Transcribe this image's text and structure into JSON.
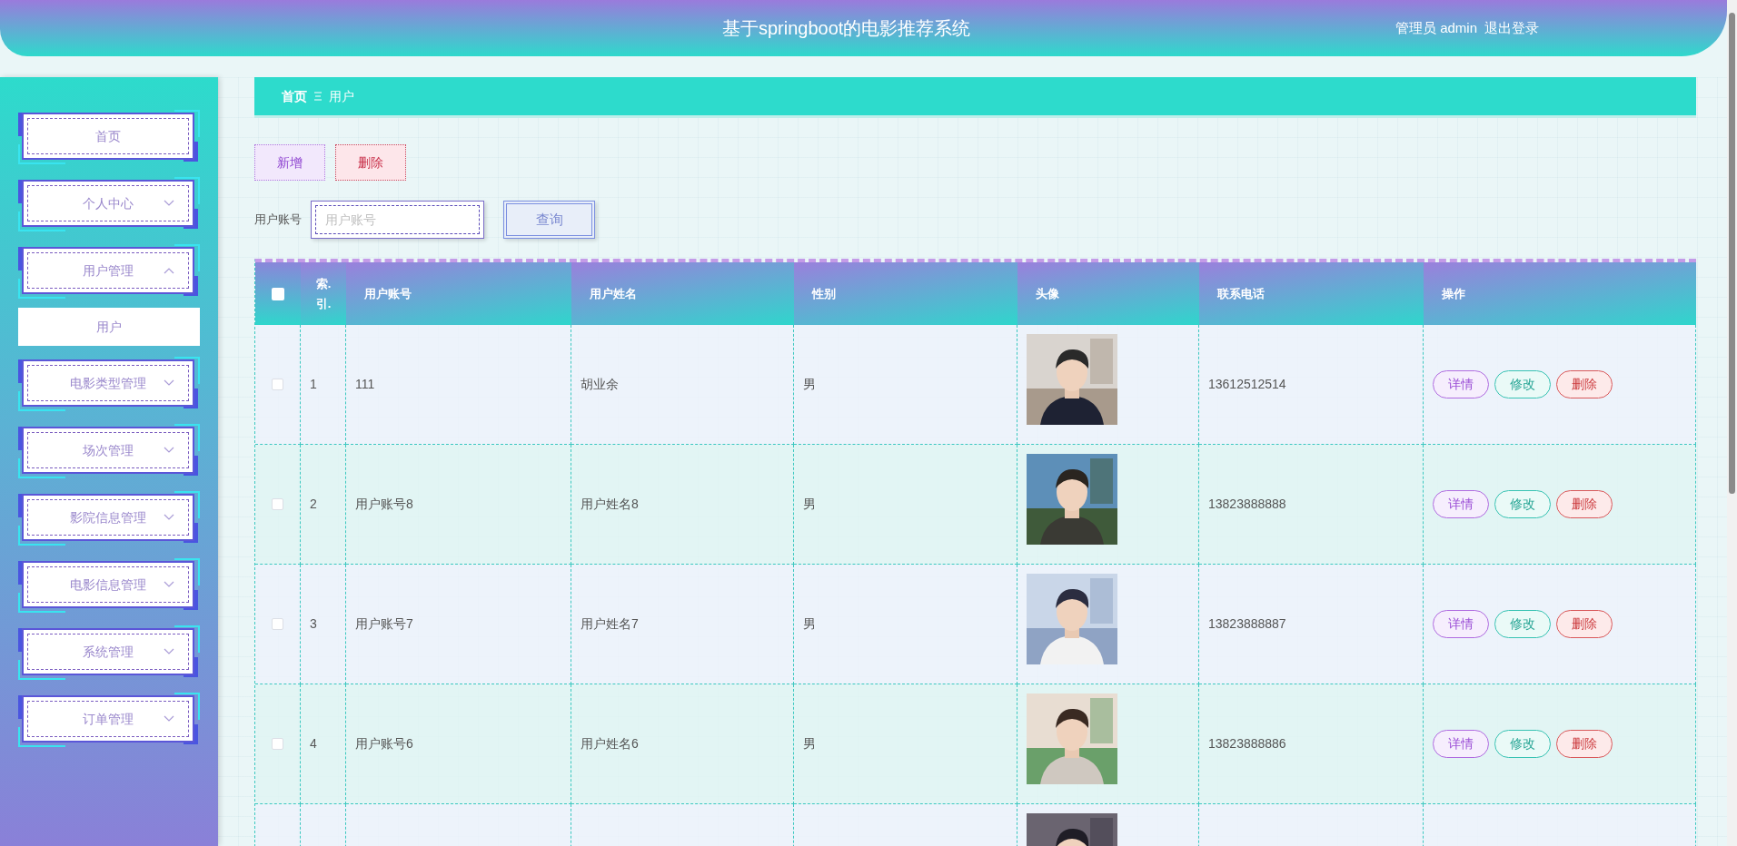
{
  "header": {
    "title": "基于springboot的电影推荐系统",
    "user_role": "管理员 admin",
    "logout": "退出登录"
  },
  "sidebar": {
    "items": [
      {
        "label": "首页",
        "kind": "link"
      },
      {
        "label": "个人中心",
        "kind": "menu",
        "expanded": false
      },
      {
        "label": "用户管理",
        "kind": "menu",
        "expanded": true,
        "children": [
          {
            "label": "用户",
            "selected": true
          }
        ]
      },
      {
        "label": "电影类型管理",
        "kind": "menu",
        "expanded": false
      },
      {
        "label": "场次管理",
        "kind": "menu",
        "expanded": false
      },
      {
        "label": "影院信息管理",
        "kind": "menu",
        "expanded": false
      },
      {
        "label": "电影信息管理",
        "kind": "menu",
        "expanded": false
      },
      {
        "label": "系统管理",
        "kind": "menu",
        "expanded": false
      },
      {
        "label": "订单管理",
        "kind": "menu",
        "expanded": false
      }
    ]
  },
  "breadcrumb": [
    "首页",
    "用户"
  ],
  "toolbar": [
    {
      "label": "新增",
      "kind": "add"
    },
    {
      "label": "删除",
      "kind": "delete"
    }
  ],
  "search": {
    "label": "用户账号",
    "placeholder": "用户账号",
    "button": "查询"
  },
  "table": {
    "select_all_checked": false,
    "columns": [
      "索.引.",
      "用户账号",
      "用户姓名",
      "性别",
      "头像",
      "联系电话",
      "操作"
    ],
    "rows": [
      {
        "checked": false,
        "index": "1",
        "account": "111",
        "name": "胡业余",
        "gender": "男",
        "avatar": {
          "kind": "picture"
        },
        "phone": "13612512514",
        "actions": [
          {
            "label": "详情",
            "kind": "detail"
          },
          {
            "label": "修改",
            "kind": "edit"
          },
          {
            "label": "删除",
            "kind": "delete"
          }
        ]
      },
      {
        "checked": false,
        "index": "2",
        "account": "用户账号8",
        "name": "用户姓名8",
        "gender": "男",
        "avatar": {
          "kind": "picture"
        },
        "phone": "13823888888",
        "actions": [
          {
            "label": "详情",
            "kind": "detail"
          },
          {
            "label": "修改",
            "kind": "edit"
          },
          {
            "label": "删除",
            "kind": "delete"
          }
        ]
      },
      {
        "checked": false,
        "index": "3",
        "account": "用户账号7",
        "name": "用户姓名7",
        "gender": "男",
        "avatar": {
          "kind": "picture"
        },
        "phone": "13823888887",
        "actions": [
          {
            "label": "详情",
            "kind": "detail"
          },
          {
            "label": "修改",
            "kind": "edit"
          },
          {
            "label": "删除",
            "kind": "delete"
          }
        ]
      },
      {
        "checked": false,
        "index": "4",
        "account": "用户账号6",
        "name": "用户姓名6",
        "gender": "男",
        "avatar": {
          "kind": "picture"
        },
        "phone": "13823888886",
        "actions": [
          {
            "label": "详情",
            "kind": "detail"
          },
          {
            "label": "修改",
            "kind": "edit"
          },
          {
            "label": "删除",
            "kind": "delete"
          }
        ]
      },
      {
        "avatar": {
          "kind": "picture"
        }
      }
    ]
  }
}
